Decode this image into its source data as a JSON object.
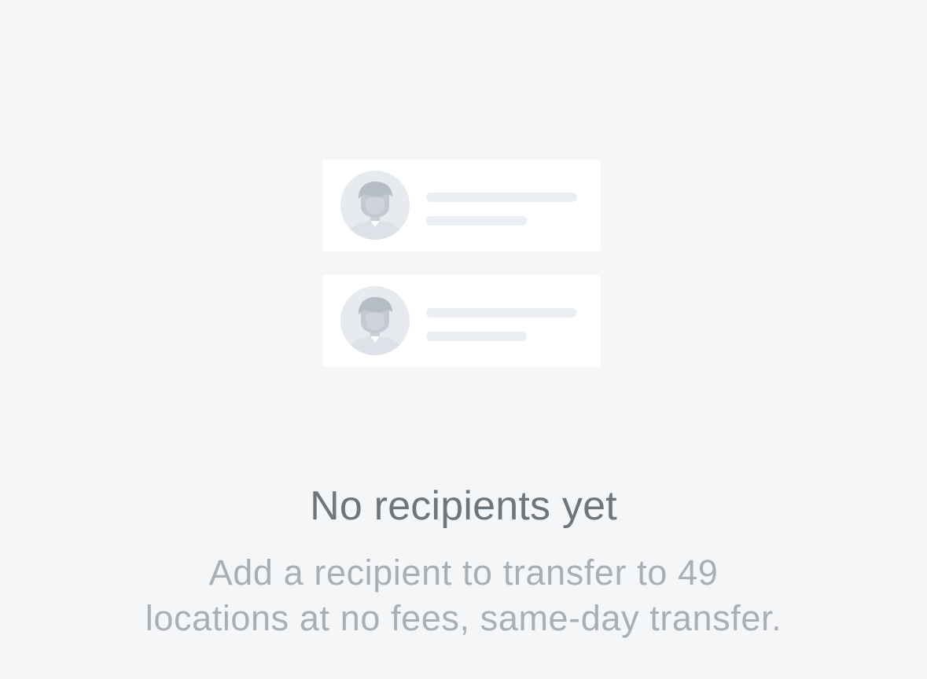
{
  "empty_state": {
    "title": "No recipients yet",
    "description_line1": "Add a recipient to transfer to 49",
    "description_line2": "locations at no fees, same-day transfer."
  },
  "colors": {
    "background": "#f5f6f8",
    "card": "#ffffff",
    "placeholder_line": "#ebeef2",
    "avatar_bg": "#e7ebef",
    "avatar_figure": "#c9cfd6",
    "title_text": "#6e767d",
    "description_text": "#a9afb6"
  },
  "icons": {
    "avatar": "person-avatar-icon"
  }
}
